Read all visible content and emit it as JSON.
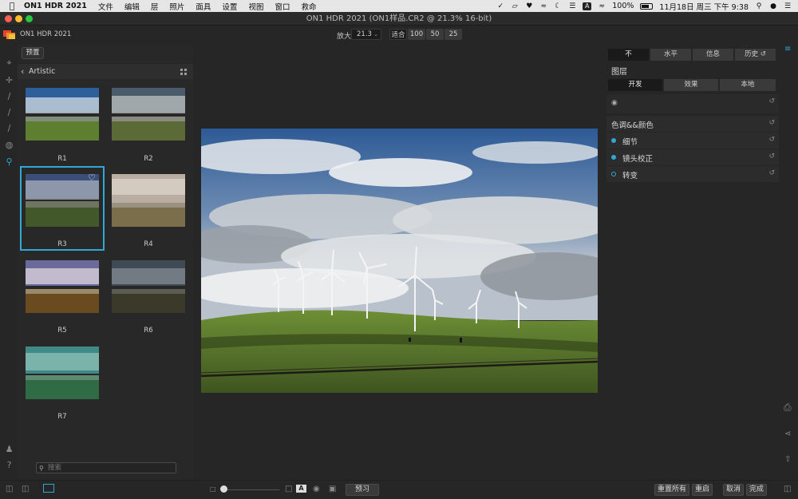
{
  "menubar": {
    "app": "ON1 HDR 2021",
    "items": [
      "文件",
      "编辑",
      "层",
      "照片",
      "面具",
      "设置",
      "视图",
      "窗口",
      "救命"
    ],
    "battery": "100%",
    "datetime": "11月18日 周三 下午 9:38"
  },
  "window": {
    "title": "ON1 HDR 2021 (ON1样品.CR2 @ 21.3% 16-bit)"
  },
  "toolbar": {
    "app_name": "ON1 HDR 2021",
    "zoom_label": "放大",
    "zoom_value": "21.3",
    "zoom_buttons": [
      "适合",
      "100",
      "50",
      "25"
    ]
  },
  "presets": {
    "tab_label": "预置",
    "category": "Artistic",
    "items": [
      {
        "label": "R1"
      },
      {
        "label": "R2"
      },
      {
        "label": "R3"
      },
      {
        "label": "R4"
      },
      {
        "label": "R5"
      },
      {
        "label": "R6"
      },
      {
        "label": "R7"
      }
    ],
    "selected": "R3",
    "search_placeholder": "搜索"
  },
  "right_panel": {
    "tabs": [
      "不",
      "水平",
      "信息",
      "历史"
    ],
    "layers_title": "图层",
    "subtabs": [
      "开发",
      "效果",
      "本地"
    ],
    "section_title": "色调&&颜色",
    "adjustments": [
      {
        "label": "细节",
        "enabled": true
      },
      {
        "label": "镜头校正",
        "enabled": true
      },
      {
        "label": "转变",
        "enabled": false
      }
    ]
  },
  "bottom": {
    "preview_label": "预习",
    "reset_all": "重置所有",
    "restart": "重启",
    "cancel": "取消",
    "done": "完成"
  },
  "colors": {
    "accent": "#2fa8d5",
    "panel_bg": "#262626"
  }
}
